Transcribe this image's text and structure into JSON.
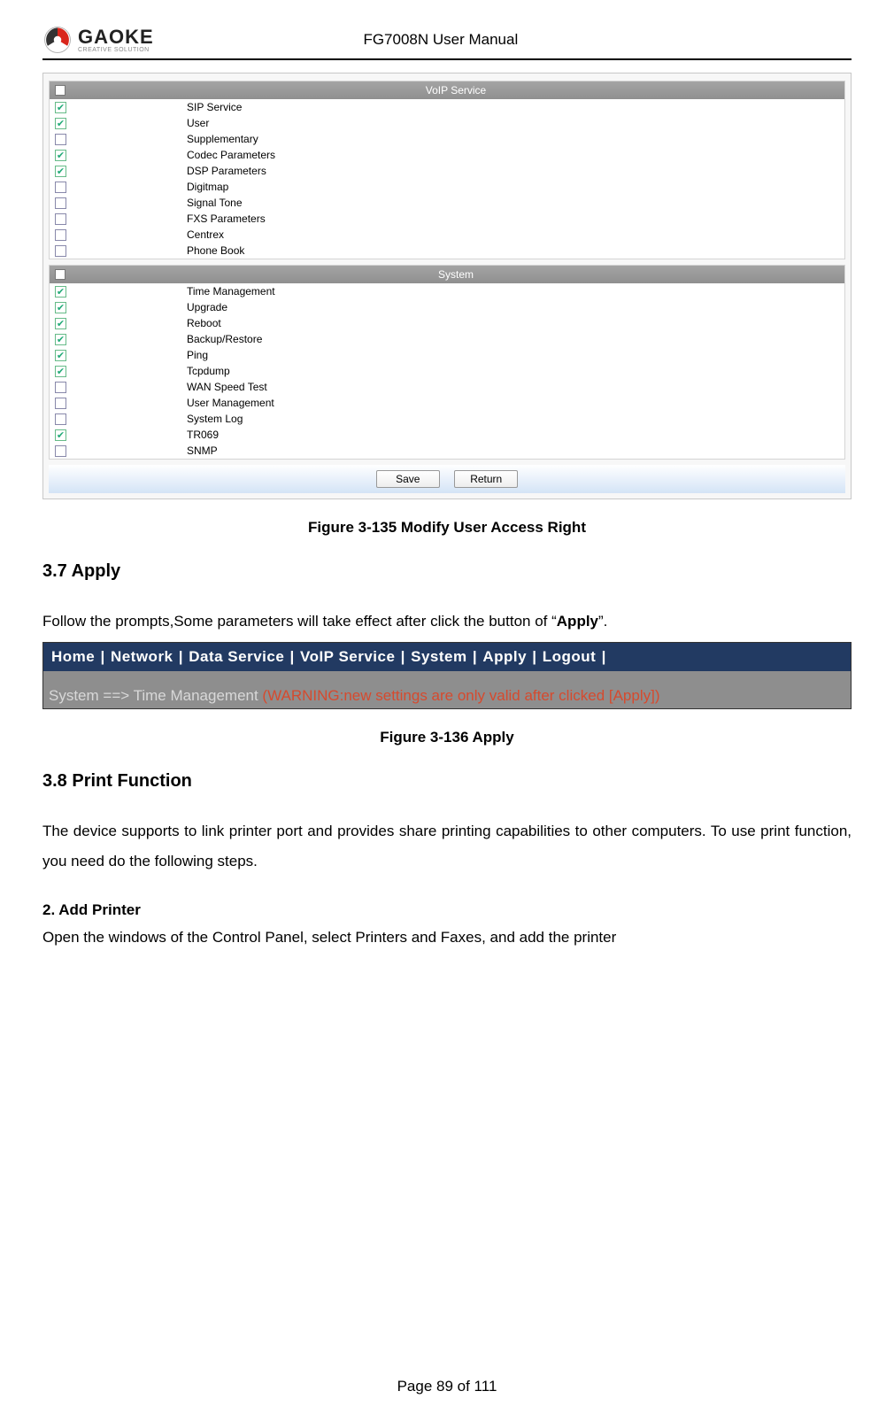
{
  "header": {
    "logo_main": "GAOKE",
    "logo_sub": "CREATIVE SOLUTION",
    "doc_title": "FG7008N User Manual"
  },
  "panel1": {
    "group_voip": {
      "title": "VoIP Service",
      "items": [
        {
          "label": "SIP Service",
          "checked": true
        },
        {
          "label": "User",
          "checked": true
        },
        {
          "label": "Supplementary",
          "checked": false
        },
        {
          "label": "Codec Parameters",
          "checked": true
        },
        {
          "label": "DSP Parameters",
          "checked": true
        },
        {
          "label": "Digitmap",
          "checked": false
        },
        {
          "label": "Signal Tone",
          "checked": false
        },
        {
          "label": "FXS Parameters",
          "checked": false
        },
        {
          "label": "Centrex",
          "checked": false
        },
        {
          "label": "Phone Book",
          "checked": false
        }
      ]
    },
    "group_system": {
      "title": "System",
      "items": [
        {
          "label": "Time Management",
          "checked": true
        },
        {
          "label": "Upgrade",
          "checked": true
        },
        {
          "label": "Reboot",
          "checked": true
        },
        {
          "label": "Backup/Restore",
          "checked": true
        },
        {
          "label": "Ping",
          "checked": true
        },
        {
          "label": "Tcpdump",
          "checked": true
        },
        {
          "label": "WAN Speed Test",
          "checked": false
        },
        {
          "label": "User Management",
          "checked": false
        },
        {
          "label": "System Log",
          "checked": false
        },
        {
          "label": "TR069",
          "checked": true
        },
        {
          "label": "SNMP",
          "checked": false
        }
      ]
    },
    "buttons": {
      "save": "Save",
      "return": "Return"
    }
  },
  "caption1": "Figure 3-135  Modify User Access Right",
  "section37": {
    "heading": "3.7 Apply",
    "para_pre": "Follow the prompts,Some parameters will take effect after click the button of “",
    "para_bold": "Apply",
    "para_post": "”."
  },
  "applybar": {
    "items": [
      "Home",
      "Network",
      "Data Service",
      "VoIP Service",
      "System",
      "Apply",
      "Logout"
    ],
    "breadcrumb_prefix": "System ==> Time Management ",
    "warning": "(WARNING:new settings are only valid after clicked [Apply])"
  },
  "caption2": "Figure 3-136  Apply",
  "section38": {
    "heading": "3.8 Print Function",
    "para": "The device supports to link printer port and provides share printing capabilities to other computers. To use print function, you need do the following steps.",
    "step_heading": "2.    Add Printer",
    "step_text": "Open the windows of the Control Panel, select Printers and Faxes, and add the printer"
  },
  "footer": {
    "page": "Page 89 of 111"
  }
}
